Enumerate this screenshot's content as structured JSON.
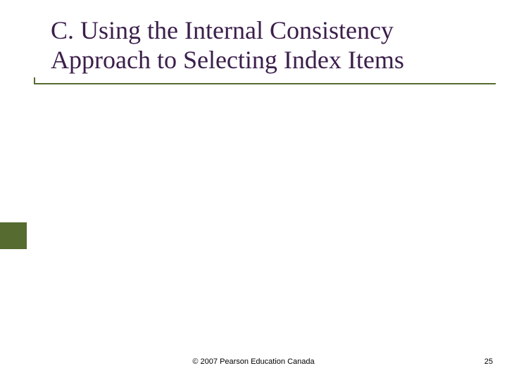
{
  "title": "C. Using the Internal Consistency Approach to Selecting Index Items",
  "footer": {
    "copyright": "© 2007 Pearson Education Canada",
    "page_number": "25"
  },
  "accent_color": "#556b2f",
  "title_color": "#3b1e4a"
}
